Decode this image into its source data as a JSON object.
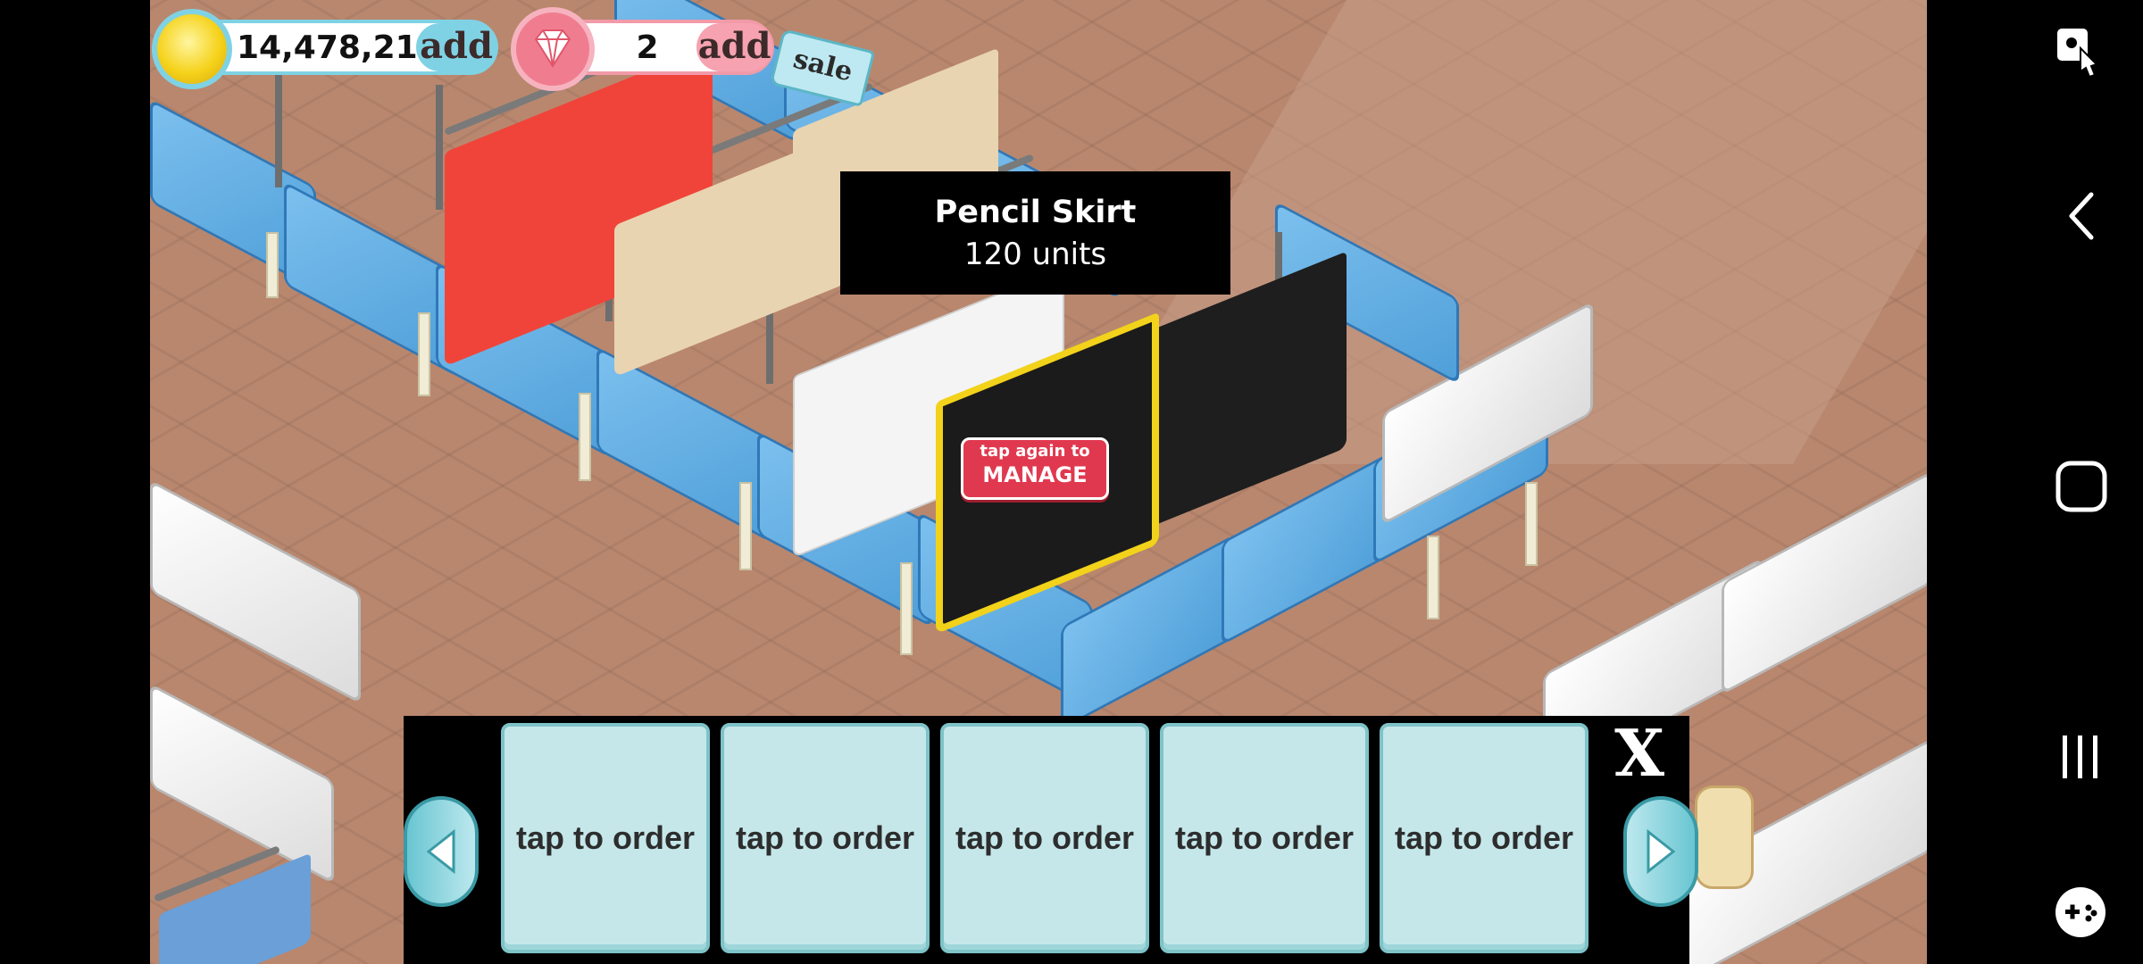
{
  "currency": {
    "coins_value": "14,478,217",
    "coins_add_label": "add",
    "gems_value": "2",
    "gems_add_label": "add",
    "sale_label": "sale"
  },
  "tooltip": {
    "item_name": "Pencil Skirt",
    "item_units": "120 units"
  },
  "manage_badge": {
    "line1": "tap again to",
    "line2": "MANAGE"
  },
  "order_panel": {
    "close_label": "X",
    "slots": [
      {
        "label": "tap to order"
      },
      {
        "label": "tap to order"
      },
      {
        "label": "tap to order"
      },
      {
        "label": "tap to order"
      },
      {
        "label": "tap to order"
      }
    ]
  },
  "icons": {
    "coin": "coin-icon",
    "gem": "gem-icon",
    "prev": "arrow-left-icon",
    "next": "arrow-right-icon",
    "nav_back": "back-icon",
    "nav_home": "home-icon",
    "nav_recents": "recents-icon",
    "nav_screenshot": "screenshot-icon",
    "nav_game": "game-controller-icon"
  },
  "colors": {
    "order_slot": "#c5e7ea",
    "manage_badge": "#e0394f",
    "counter_blue": "#5aa8e0",
    "selected_outline": "#f2d21a"
  }
}
